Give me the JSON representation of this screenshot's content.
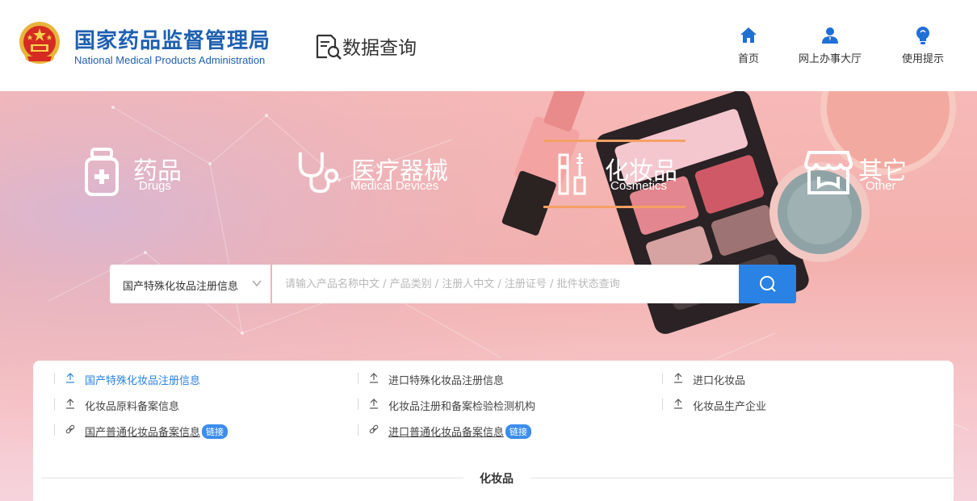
{
  "header": {
    "brand_cn": "国家药品监督管理局",
    "brand_en": "National Medical Products Administration",
    "data_query_title": "数据查询",
    "nav": [
      {
        "label": "首页",
        "icon": "home-icon"
      },
      {
        "label": "网上办事大厅",
        "icon": "user-icon"
      },
      {
        "label": "使用提示",
        "icon": "lightbulb-icon"
      }
    ]
  },
  "categories": [
    {
      "cn": "药品",
      "en": "Drugs",
      "icon": "medicine-bottle-icon",
      "active": false
    },
    {
      "cn": "医疗器械",
      "en": "Medical Devices",
      "icon": "stethoscope-icon",
      "active": false
    },
    {
      "cn": "化妆品",
      "en": "Cosmetics",
      "icon": "cosmetics-icon",
      "active": true
    },
    {
      "cn": "其它",
      "en": "Other",
      "icon": "store-icon",
      "active": false
    }
  ],
  "search": {
    "selected_type": "国产特殊化妆品注册信息",
    "placeholder": "请输入产品名称中文 / 产品类别 / 注册人中文 / 注册证号 / 批件状态查询"
  },
  "links": [
    {
      "label": "国产特殊化妆品注册信息",
      "icon": "upload-icon",
      "active": true
    },
    {
      "label": "进口特殊化妆品注册信息",
      "icon": "upload-icon"
    },
    {
      "label": "进口化妆品",
      "icon": "upload-icon"
    },
    {
      "label": "化妆品原料备案信息",
      "icon": "upload-icon"
    },
    {
      "label": "化妆品注册和备案检验检测机构",
      "icon": "upload-icon"
    },
    {
      "label": "化妆品生产企业",
      "icon": "upload-icon"
    },
    {
      "label": "国产普通化妆品备案信息",
      "icon": "link-icon",
      "badge": "链接"
    },
    {
      "label": "进口普通化妆品备案信息",
      "icon": "link-icon",
      "badge": "链接"
    }
  ],
  "section_title": "化妆品",
  "colors": {
    "brand_blue": "#1e5fb1",
    "accent_blue": "#2a82e4",
    "active_underline": "#f5a064"
  }
}
